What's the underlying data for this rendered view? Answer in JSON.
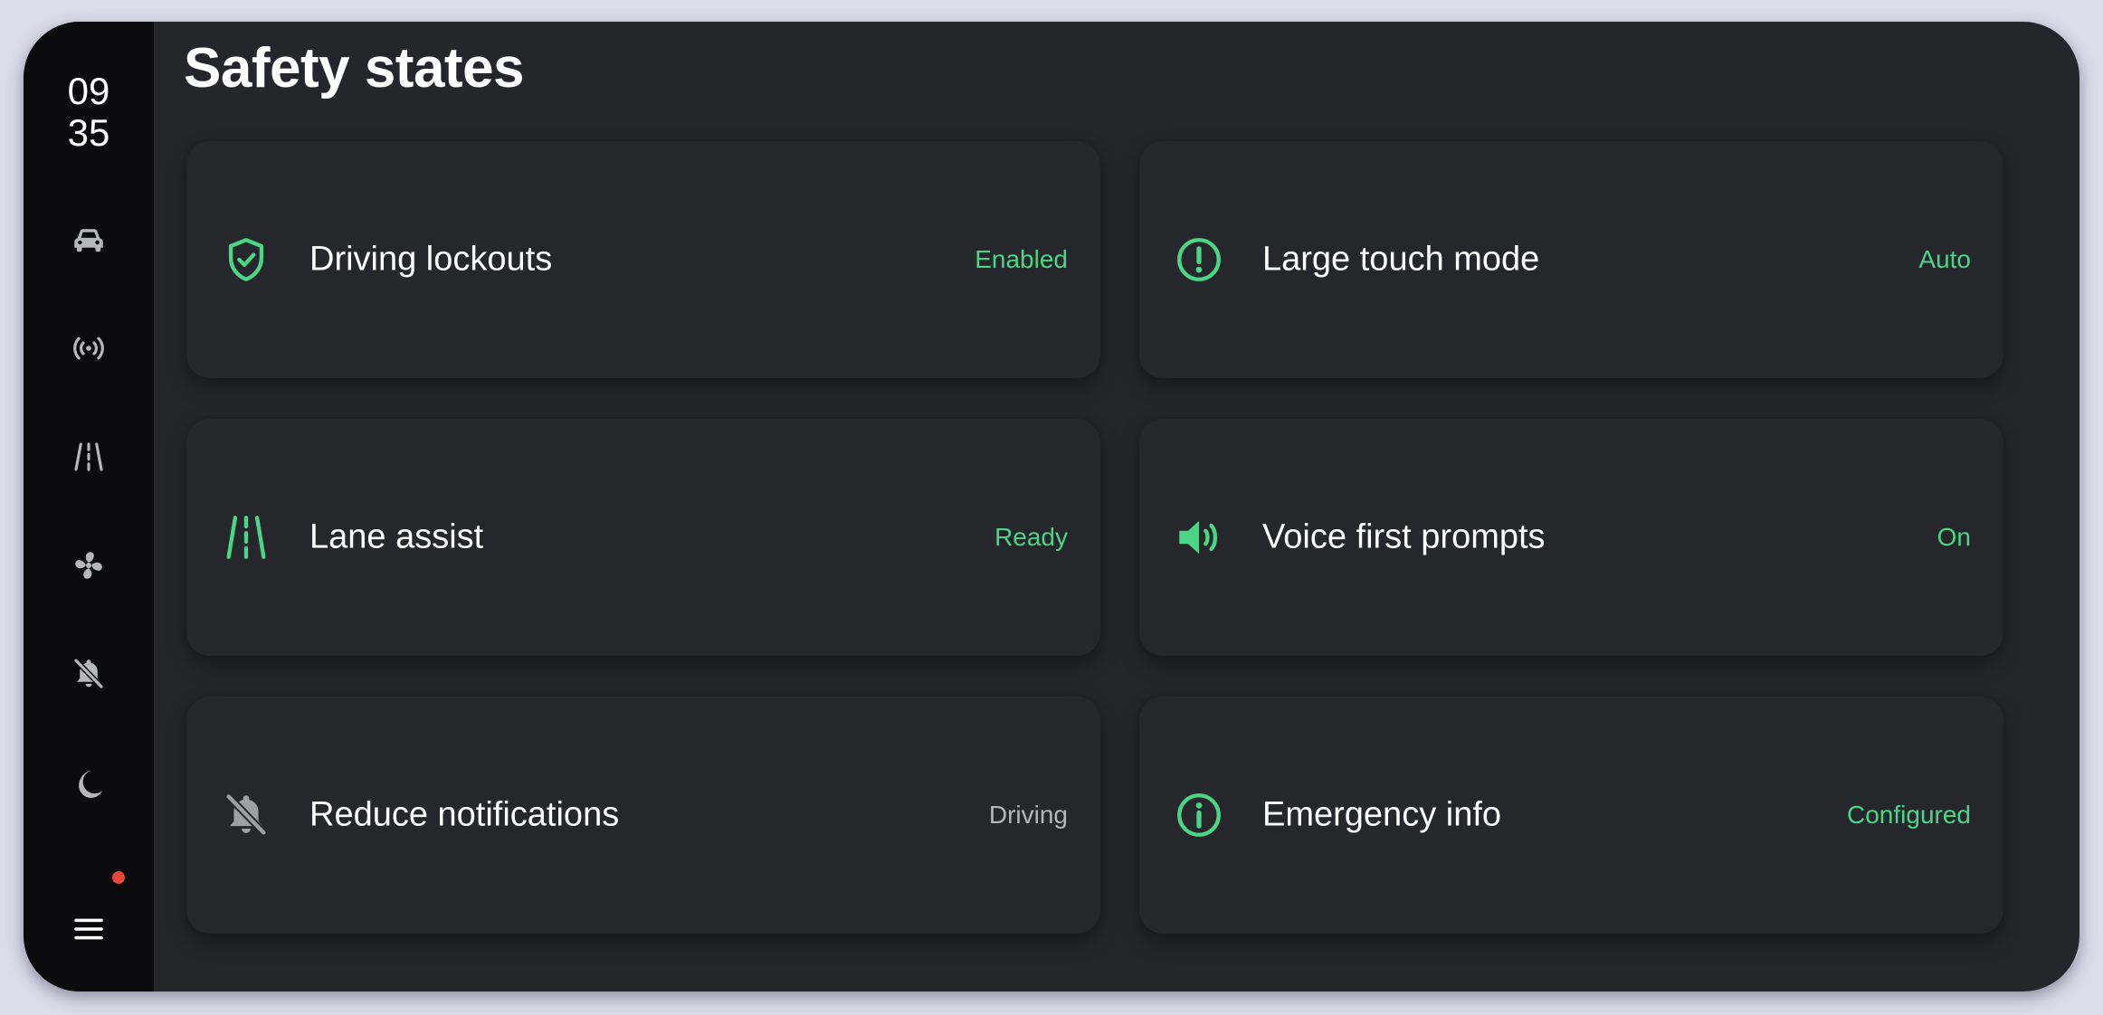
{
  "clock": {
    "hours": "09",
    "minutes": "35"
  },
  "sidebar": {
    "items": [
      {
        "icon": "car-icon",
        "label": ""
      },
      {
        "icon": "broadcast-icon",
        "label": ""
      },
      {
        "icon": "road-icon",
        "label": ""
      },
      {
        "icon": "fan-icon",
        "label": ""
      },
      {
        "icon": "bell-off-icon",
        "label": ""
      },
      {
        "icon": "moon-icon",
        "label": ""
      },
      {
        "icon": "menu-icon",
        "label": "",
        "notification_dot": true
      }
    ]
  },
  "page": {
    "title": "Safety states"
  },
  "cards": [
    {
      "label": "Driving lockouts",
      "status": "Enabled",
      "icon": "shield-check-icon",
      "status_color": "#4cd584"
    },
    {
      "label": "Large touch mode",
      "status": "Auto",
      "icon": "alert-circle-icon",
      "status_color": "#4cd584"
    },
    {
      "label": "Lane assist",
      "status": "Ready",
      "icon": "lane-icon",
      "status_color": "#4cd584"
    },
    {
      "label": "Voice first prompts",
      "status": "On",
      "icon": "speaker-icon",
      "status_color": "#4cd584"
    },
    {
      "label": "Reduce notifications",
      "status": "Driving",
      "icon": "bell-off-icon",
      "status_color": "#b6b7bd"
    },
    {
      "label": "Emergency info",
      "status": "Configured",
      "icon": "info-circle-icon",
      "status_color": "#4cd584"
    }
  ],
  "colors": {
    "accent": "#4cd584",
    "background": "#25262c",
    "sidebar": "#0b0b0d",
    "notification": "#e8453c"
  }
}
